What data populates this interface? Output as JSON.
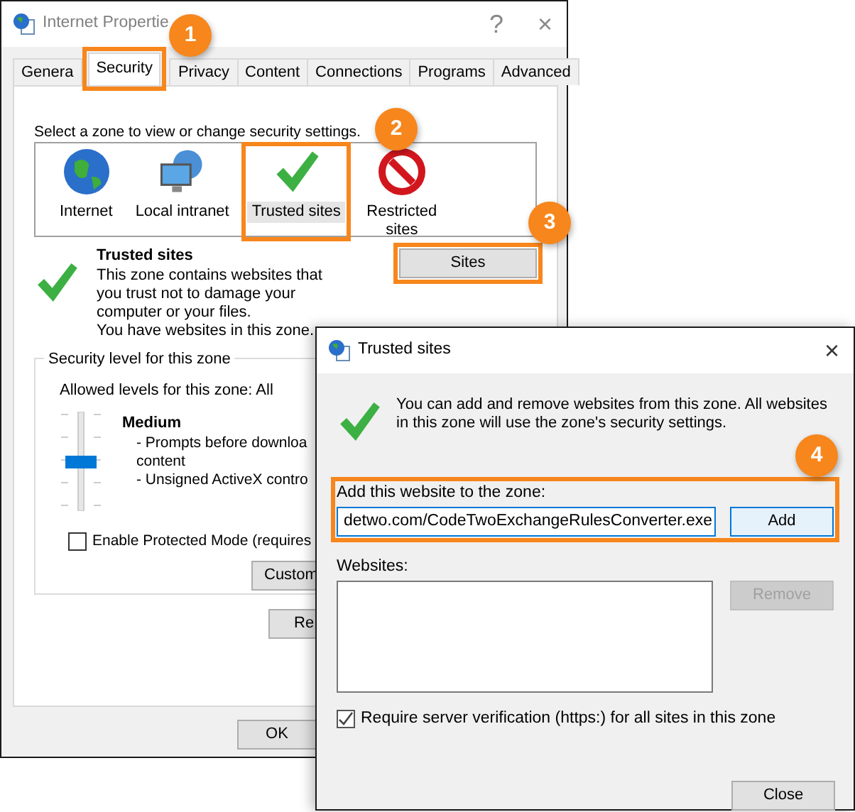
{
  "back_window": {
    "title": "Internet Propertie",
    "help": "?",
    "close": "×",
    "tabs": [
      {
        "label": "Genera",
        "selected": false
      },
      {
        "label": "Security",
        "selected": true
      },
      {
        "label": "Privacy",
        "selected": false
      },
      {
        "label": "Content",
        "selected": false
      },
      {
        "label": "Connections",
        "selected": false
      },
      {
        "label": "Programs",
        "selected": false
      },
      {
        "label": "Advanced",
        "selected": false
      }
    ],
    "zone_prompt": "Select a zone to view or change security settings.",
    "zones": [
      {
        "label": "Internet",
        "kind": "globe",
        "selected": false
      },
      {
        "label": "Local intranet",
        "kind": "computer",
        "selected": false
      },
      {
        "label": "Trusted sites",
        "kind": "check",
        "selected": true
      },
      {
        "label": "Restricted sites",
        "kind": "forbidden",
        "selected": false
      }
    ],
    "zone_heading": "Trusted sites",
    "zone_description": [
      "This zone contains websites that you trust not to damage your computer or your files.",
      "You have websites in this zone."
    ],
    "sites_button": "Sites",
    "security_level": {
      "legend": "Security level for this zone",
      "allowed": "Allowed levels for this zone: All",
      "level": 0.5,
      "name": "Medium",
      "notes": [
        "- Prompts before downloa",
        "content",
        "- Unsigned ActiveX contro"
      ]
    },
    "protected_mode": {
      "label": "Enable Protected Mode (requires",
      "checked": false
    },
    "custom_button": "Custom",
    "reset_button": "Re",
    "ok_button": "OK"
  },
  "front_window": {
    "title": "Trusted sites",
    "close": "×",
    "info": "You can add and remove websites from this zone. All websites in this zone will use the zone's security settings.",
    "add_label": "Add this website to the zone:",
    "add_value": "detwo.com/CodeTwoExchangeRulesConverter.exe",
    "add_button": "Add",
    "websites_label": "Websites:",
    "remove_button": {
      "label": "Remove",
      "disabled": true
    },
    "require_https": {
      "label": "Require server verification (https:) for all sites in this zone",
      "checked": true
    },
    "close_button": "Close"
  },
  "callouts": [
    "1",
    "2",
    "3",
    "4"
  ]
}
